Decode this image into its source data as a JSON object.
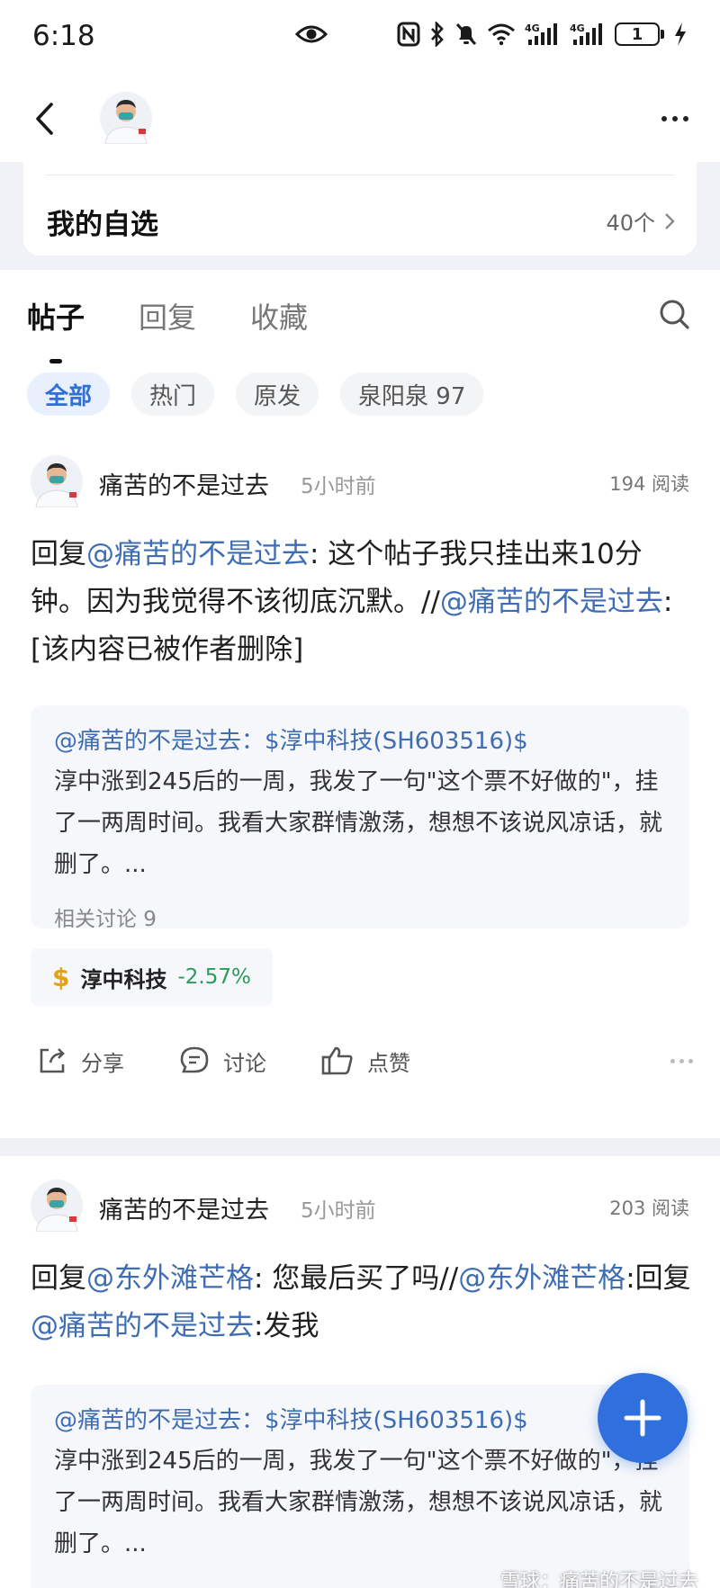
{
  "status_bar": {
    "time": "6:18",
    "battery": "1",
    "signal_labels": [
      "4G",
      "4G"
    ]
  },
  "header": {
    "back_icon": "chevron-left-icon",
    "more_icon": "more-dots-icon"
  },
  "watchlist": {
    "title": "我的自选",
    "count": "40个"
  },
  "tabs": [
    {
      "label": "帖子",
      "active": true
    },
    {
      "label": "回复",
      "active": false
    },
    {
      "label": "收藏",
      "active": false
    }
  ],
  "filters": [
    {
      "label": "全部",
      "active": true
    },
    {
      "label": "热门",
      "active": false
    },
    {
      "label": "原发",
      "active": false
    },
    {
      "label": "泉阳泉 97",
      "active": false
    }
  ],
  "posts": [
    {
      "author": "痛苦的不是过去",
      "time": "5小时前",
      "reads": "194 阅读",
      "text_parts": [
        {
          "t": "回复",
          "m": false
        },
        {
          "t": "@痛苦的不是过去",
          "m": true
        },
        {
          "t": ": 这个帖子我只挂出来10分钟。因为我觉得不该彻底沉默。//",
          "m": false
        },
        {
          "t": "@痛苦的不是过去",
          "m": true
        },
        {
          "t": ":[该内容已被作者删除]",
          "m": false
        }
      ],
      "quote_head": "@痛苦的不是过去：$淳中科技(SH603516)$",
      "quote_body": "淳中涨到245后的一周，我发了一句\"这个票不好做的\"，挂了一两周时间。我看大家群情激荡，想想不该说风凉话，就删了。...",
      "quote_meta": "相关讨论 9",
      "stock_name": "淳中科技",
      "stock_change": "-2.57%",
      "stock_symbol": "$"
    },
    {
      "author": "痛苦的不是过去",
      "time": "5小时前",
      "reads": "203 阅读",
      "text_parts": [
        {
          "t": "回复",
          "m": false
        },
        {
          "t": "@东外滩芒格",
          "m": true
        },
        {
          "t": ": 您最后买了吗//",
          "m": false
        },
        {
          "t": "@东外滩芒格",
          "m": true
        },
        {
          "t": ":回复",
          "m": false
        },
        {
          "t": "@痛苦的不是过去",
          "m": true
        },
        {
          "t": ":发我",
          "m": false
        }
      ],
      "quote_head": "@痛苦的不是过去：$淳中科技(SH603516)$",
      "quote_body": "淳中涨到245后的一周，我发了一句\"这个票不好做的\"，挂了一两周时间。我看大家群情激荡，想想不该说风凉话，就删了。..."
    }
  ],
  "actions": {
    "share": "分享",
    "discuss": "讨论",
    "like": "点赞"
  },
  "watermark": "雪球：痛苦的不是过去",
  "colors": {
    "mention": "#3f6db3",
    "accent": "#2f6fde",
    "down": "#2a9a5b"
  }
}
